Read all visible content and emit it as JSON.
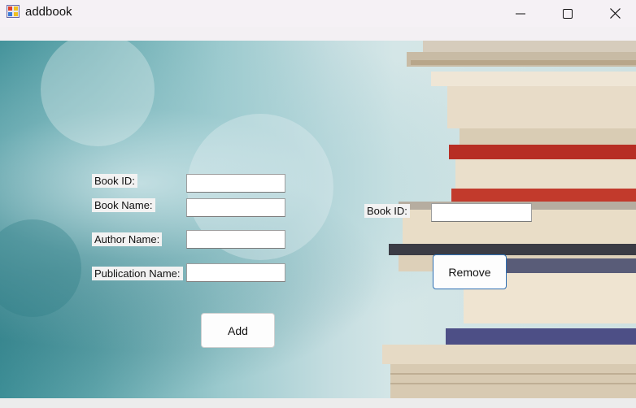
{
  "window": {
    "title": "addbook"
  },
  "form": {
    "book_id_label": "Book ID:",
    "book_name_label": "Book Name:",
    "author_name_label": "Author Name:",
    "publication_name_label": "Publication Name:",
    "book_id_value": "",
    "book_name_value": "",
    "author_name_value": "",
    "publication_name_value": "",
    "add_label": "Add"
  },
  "remove": {
    "book_id_label": "Book ID:",
    "book_id_value": "",
    "remove_label": "Remove"
  },
  "icons": {
    "app": "app-form-icon",
    "minimize": "minimize-icon",
    "maximize": "maximize-icon",
    "close": "close-icon"
  }
}
